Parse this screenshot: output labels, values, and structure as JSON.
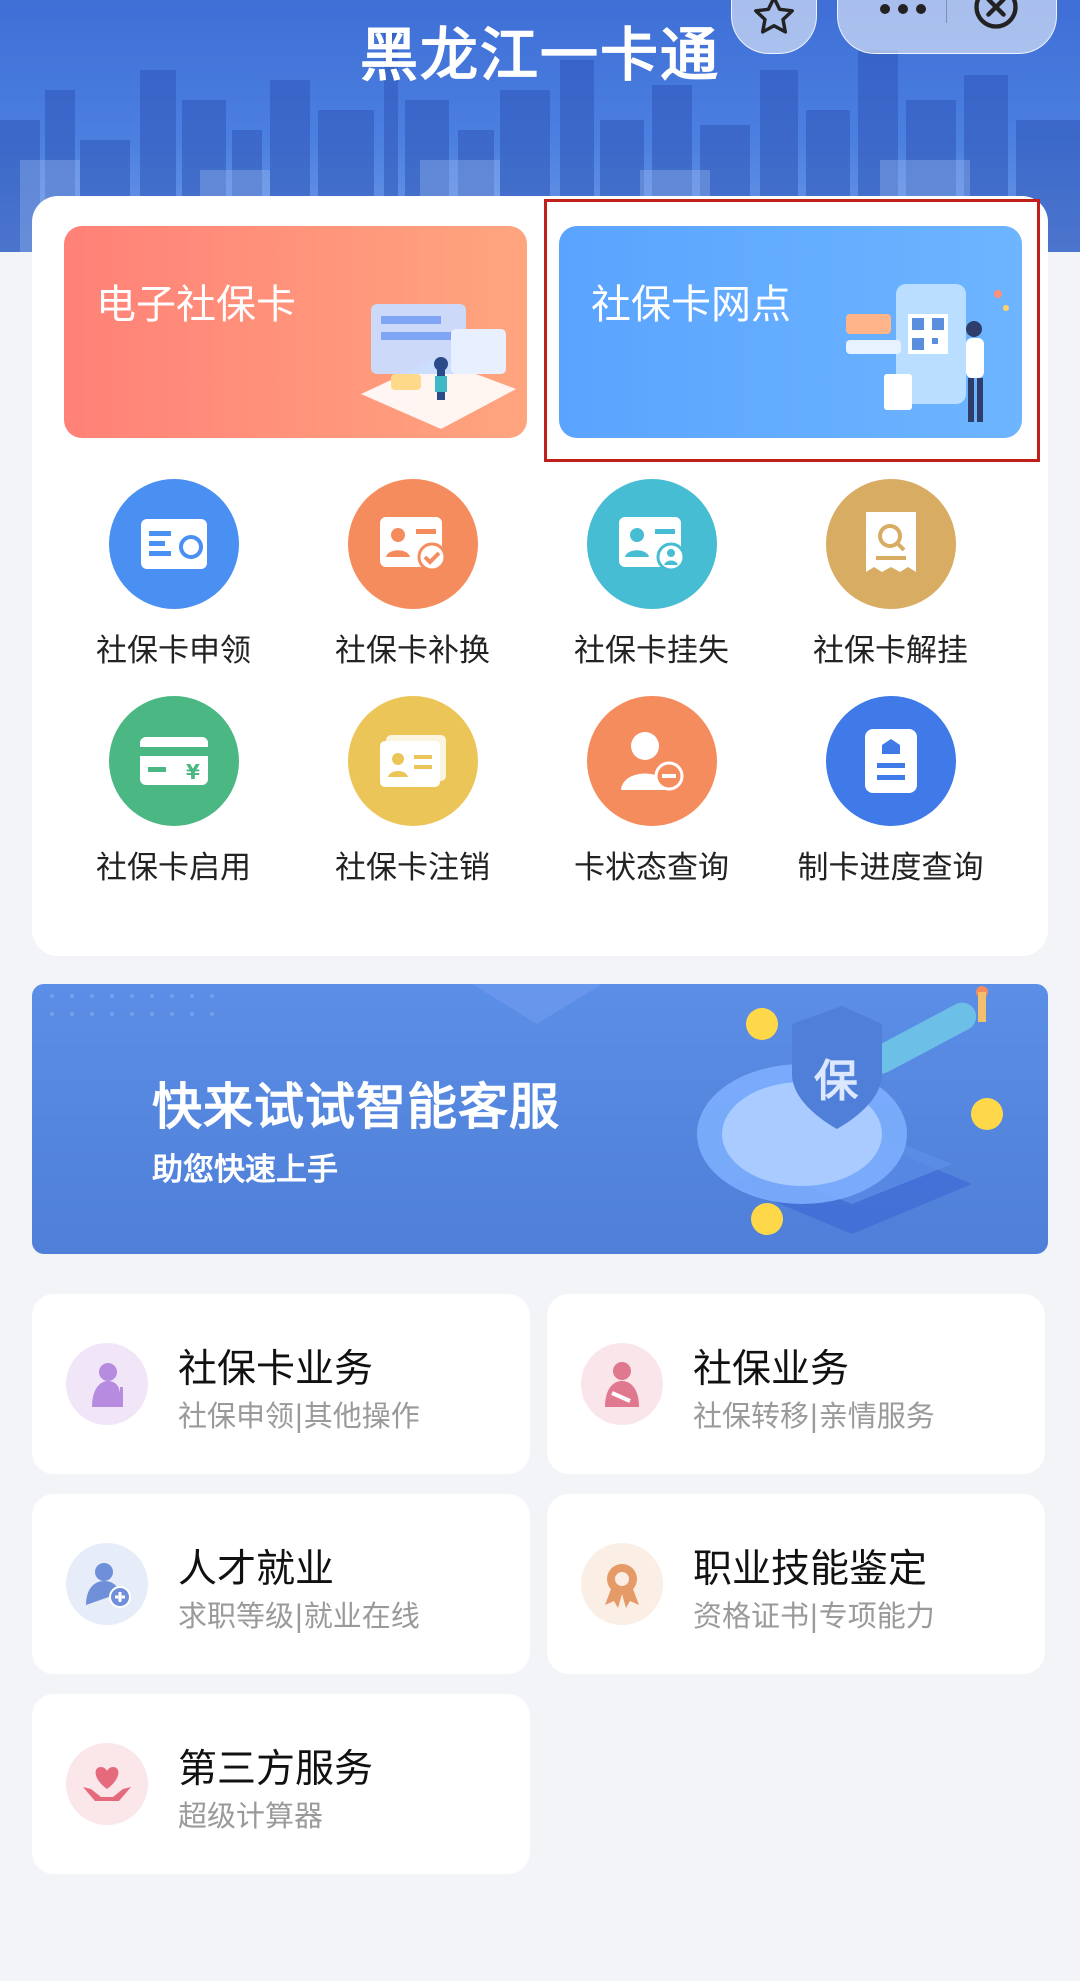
{
  "header": {
    "title": "黑龙江一卡通"
  },
  "capsule": {
    "favorite_icon": "star-icon",
    "more_icon": "more-dots-icon",
    "close_icon": "close-circle-icon"
  },
  "hero_cards": [
    {
      "label": "电子社保卡",
      "color": "#ff8f7b"
    },
    {
      "label": "社保卡网点",
      "color": "#62acff"
    }
  ],
  "grid": [
    {
      "label": "社保卡申领",
      "icon": "card-apply-icon",
      "color": "#4a8ff2"
    },
    {
      "label": "社保卡补换",
      "icon": "card-replace-icon",
      "color": "#f58c5e"
    },
    {
      "label": "社保卡挂失",
      "icon": "card-report-loss-icon",
      "color": "#47bdd3"
    },
    {
      "label": "社保卡解挂",
      "icon": "card-unfreeze-icon",
      "color": "#d8ac63"
    },
    {
      "label": "社保卡启用",
      "icon": "card-activate-icon",
      "color": "#4bb883"
    },
    {
      "label": "社保卡注销",
      "icon": "card-cancel-icon",
      "color": "#ecc559"
    },
    {
      "label": "卡状态查询",
      "icon": "status-query-icon",
      "color": "#f58c5e"
    },
    {
      "label": "制卡进度查询",
      "icon": "progress-query-icon",
      "color": "#3f7ae8"
    }
  ],
  "banner": {
    "title": "快来试试智能客服",
    "subtitle": "助您快速上手",
    "badge": "保"
  },
  "services": [
    {
      "title": "社保卡业务",
      "subtitle": "社保申领|其他操作",
      "icon": "elderly-person-icon",
      "color": "#b68be0"
    },
    {
      "title": "社保业务",
      "subtitle": "社保转移|亲情服务",
      "icon": "person-arm-sling-icon",
      "color": "#e0798f"
    },
    {
      "title": "人才就业",
      "subtitle": "求职等级|就业在线",
      "icon": "person-add-icon",
      "color": "#6f8fd8"
    },
    {
      "title": "职业技能鉴定",
      "subtitle": "资格证书|专项能力",
      "icon": "award-badge-icon",
      "color": "#e59a67"
    },
    {
      "title": "第三方服务",
      "subtitle": "超级计算器",
      "icon": "heart-hands-icon",
      "color": "#e56a7c"
    }
  ]
}
